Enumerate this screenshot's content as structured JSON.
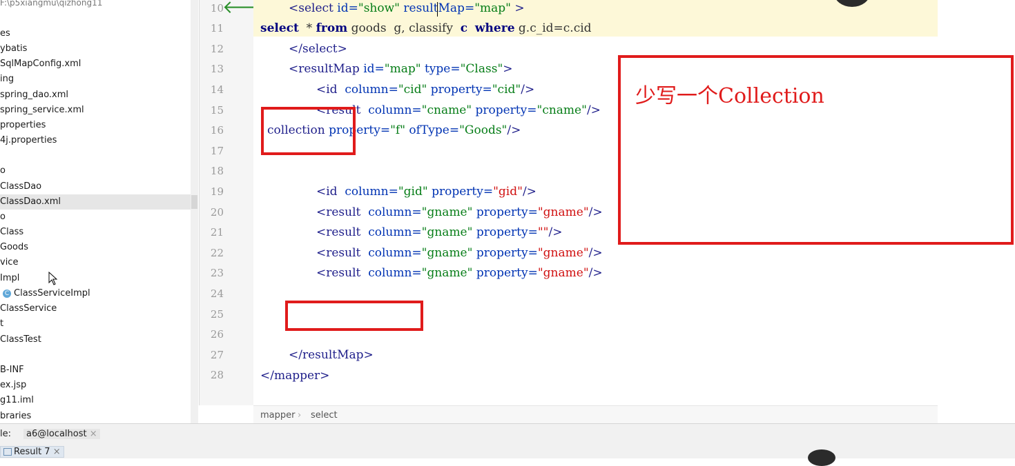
{
  "tree": {
    "path": "F:\\p5xiangmu\\qizhong11",
    "items": [
      {
        "label": "es"
      },
      {
        "label": "ybatis"
      },
      {
        "label": "SqlMapConfig.xml"
      },
      {
        "label": "ing"
      },
      {
        "label": "spring_dao.xml"
      },
      {
        "label": "spring_service.xml"
      },
      {
        "label": "properties"
      },
      {
        "label": "4j.properties"
      },
      {
        "label": ""
      },
      {
        "label": "o"
      },
      {
        "label": "ClassDao"
      },
      {
        "label": "ClassDao.xml"
      },
      {
        "label": "o"
      },
      {
        "label": "Class"
      },
      {
        "label": "Goods"
      },
      {
        "label": "vice"
      },
      {
        "label": "Impl"
      },
      {
        "label": "ClassServiceImpl"
      },
      {
        "label": "ClassService"
      },
      {
        "label": "t"
      },
      {
        "label": "ClassTest"
      },
      {
        "label": ""
      },
      {
        "label": "B-INF"
      },
      {
        "label": "ex.jsp"
      },
      {
        "label": "g11.iml"
      },
      {
        "label": "braries"
      }
    ],
    "class_icon_glyph": "C"
  },
  "editor": {
    "line_numbers": [
      "10",
      "11",
      "12",
      "13",
      "14",
      "15",
      "16",
      "17",
      "18",
      "19",
      "20",
      "21",
      "22",
      "23",
      "24",
      "25",
      "26",
      "27",
      "28"
    ],
    "lines": {
      "l10": {
        "open": "<select ",
        "a1": "id=",
        "v1": "\"show\"",
        "a2": " resultMap=",
        "v2": "\"map\"",
        "close": " >"
      },
      "l11": {
        "k1": "select",
        "p1": "  * ",
        "k2": "from",
        "p2": " goods  g, classify  ",
        "k3": "c",
        "p3": "  ",
        "k4": "where",
        "p4": " g.c_id=c.cid"
      },
      "l12": {
        "t": "</select>"
      },
      "l13": {
        "open": "<resultMap ",
        "a1": "id=",
        "v1": "\"map\"",
        "a2": " type=",
        "v2": "\"Class\"",
        "close": ">"
      },
      "l14": {
        "open": "<id  ",
        "a1": "column=",
        "v1": "\"cid\"",
        "a2": " property=",
        "v2": "\"cid\"",
        "close": "/>"
      },
      "l15": {
        "open": "<result  ",
        "a1": "column=",
        "v1": "\"cname\"",
        "a2": " property=",
        "v2": "\"cname\"",
        "close": "/>"
      },
      "l16": {
        "open": "collection ",
        "a1": "property=",
        "v1": "\"f\"",
        "a2": " ofType=",
        "v2": "\"Goods\"",
        "close": "/>"
      },
      "l19": {
        "open": "<id  ",
        "a1": "column=",
        "v1": "\"gid\"",
        "a2": " property=",
        "v2": "\"gid\"",
        "close": "/>"
      },
      "l20": {
        "open": "<result  ",
        "a1": "column=",
        "v1": "\"gname\"",
        "a2": " property=",
        "v2": "\"gname\"",
        "close": "/>"
      },
      "l21": {
        "open": "<result  ",
        "a1": "column=",
        "v1": "\"gname\"",
        "a2": " property=",
        "v2": "\"\"",
        "close": "/>"
      },
      "l22": {
        "open": "<result  ",
        "a1": "column=",
        "v1": "\"gname\"",
        "a2": " property=",
        "v2": "\"gname\"",
        "close": "/>"
      },
      "l23": {
        "open": "<result  ",
        "a1": "column=",
        "v1": "\"gname\"",
        "a2": " property=",
        "v2": "\"gname\"",
        "close": "/>"
      },
      "l27": {
        "t": "</resultMap>"
      },
      "l28": {
        "t": "</mapper>"
      }
    }
  },
  "annotation": {
    "note": "少写一个Collection"
  },
  "breadcrumb": {
    "first": "mapper",
    "sep": "›",
    "second": "select"
  },
  "status": {
    "label": "le:",
    "connection": "a6@localhost",
    "close": "×",
    "tab": "Result 7",
    "tab_close": "×"
  },
  "colors": {
    "annotation": "#e01b1b",
    "arrow": "#2a8f2a",
    "highlight_line": "#fdf8d8"
  }
}
